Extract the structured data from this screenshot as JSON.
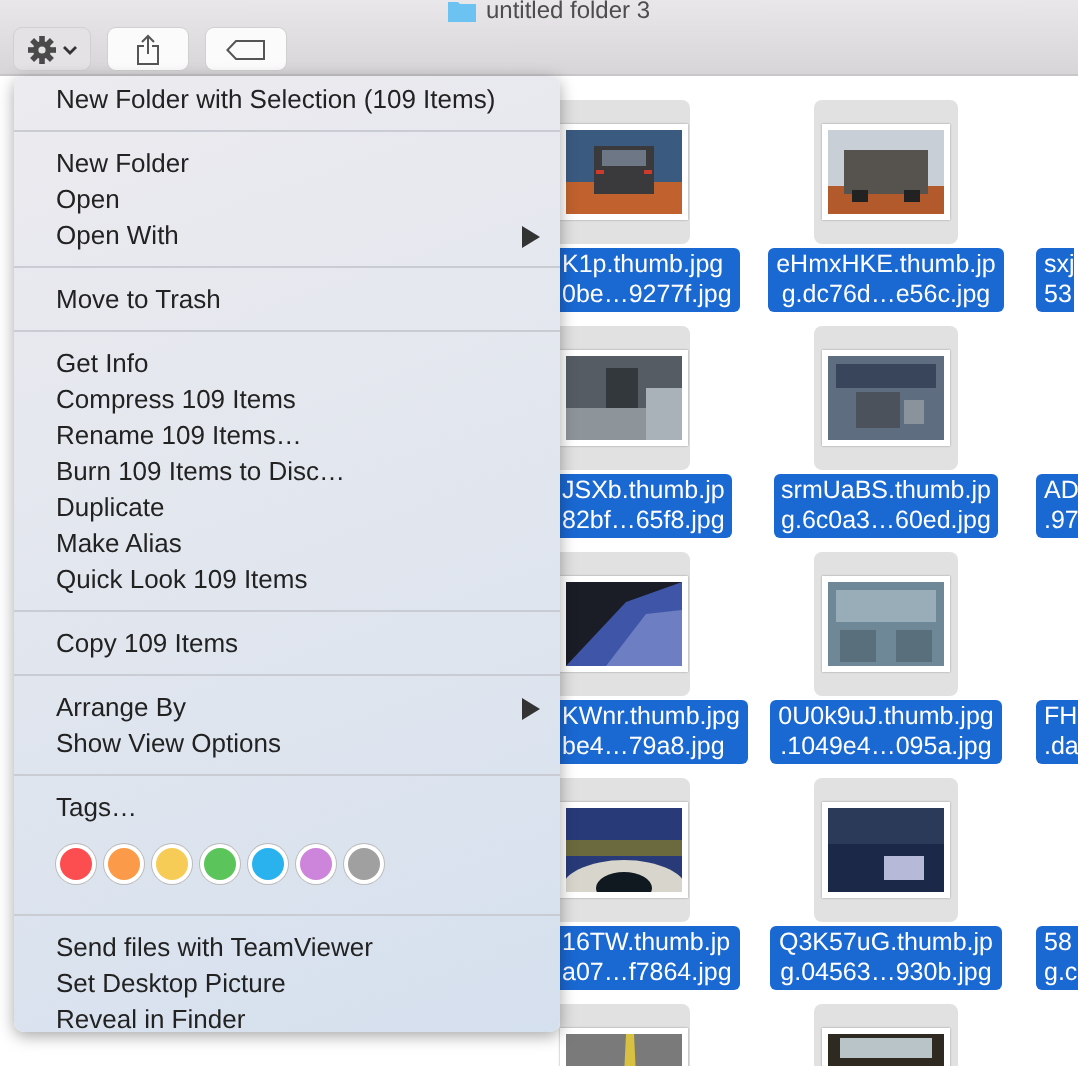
{
  "window": {
    "title": "untitled folder 3"
  },
  "toolbar": {
    "buttons": [
      {
        "kind": "action"
      },
      {
        "kind": "share"
      },
      {
        "kind": "tag"
      }
    ]
  },
  "files": [
    {
      "kind": "picture",
      "selected": true,
      "name": [
        "K1p.thumb.jpg",
        "0be…9277f.jpg"
      ]
    },
    {
      "kind": "picture",
      "selected": true,
      "name": [
        "eHmxHKE.thumb.jp",
        "g.dc76d…e56c.jpg"
      ]
    },
    {
      "kind": "label",
      "selected": true,
      "name": [
        "sxj",
        "53"
      ]
    },
    {
      "kind": "picture",
      "selected": true,
      "name": [
        "JSXb.thumb.jp",
        "82bf…65f8.jpg"
      ]
    },
    {
      "kind": "picture",
      "selected": true,
      "name": [
        "srmUaBS.thumb.jp",
        "g.6c0a3…60ed.jpg"
      ]
    },
    {
      "kind": "label",
      "selected": true,
      "name": [
        "AD",
        ".97"
      ]
    },
    {
      "kind": "picture",
      "selected": true,
      "name": [
        "KWnr.thumb.jpg",
        "be4…79a8.jpg"
      ]
    },
    {
      "kind": "picture",
      "selected": true,
      "name": [
        "0U0k9uJ.thumb.jpg",
        ".1049e4…095a.jpg"
      ]
    },
    {
      "kind": "label",
      "selected": true,
      "name": [
        "FH",
        ".da"
      ]
    },
    {
      "kind": "picture",
      "selected": true,
      "name": [
        "16TW.thumb.jp",
        "a07…f7864.jpg"
      ]
    },
    {
      "kind": "picture",
      "selected": true,
      "name": [
        "Q3K57uG.thumb.jp",
        "g.04563…930b.jpg"
      ]
    },
    {
      "kind": "label",
      "selected": true,
      "name": [
        "58",
        "g.c"
      ]
    },
    {
      "kind": "picture"
    },
    {
      "kind": "picture"
    }
  ],
  "menu": {
    "sections": [
      [
        {
          "kind": "item",
          "label": "New Folder with Selection (109 Items)"
        }
      ],
      [
        {
          "kind": "item",
          "label": "New Folder"
        },
        {
          "kind": "item",
          "label": "Open"
        },
        {
          "kind": "submenu",
          "label": "Open With"
        }
      ],
      [
        {
          "kind": "item",
          "label": "Move to Trash"
        }
      ],
      [
        {
          "kind": "item",
          "label": "Get Info"
        },
        {
          "kind": "item",
          "label": "Compress 109 Items"
        },
        {
          "kind": "item",
          "label": "Rename 109 Items…"
        },
        {
          "kind": "item",
          "label": "Burn 109 Items to Disc…"
        },
        {
          "kind": "item",
          "label": "Duplicate"
        },
        {
          "kind": "item",
          "label": "Make Alias"
        },
        {
          "kind": "item",
          "label": "Quick Look 109 Items"
        }
      ],
      [
        {
          "kind": "item",
          "label": "Copy 109 Items"
        }
      ],
      [
        {
          "kind": "submenu",
          "label": "Arrange By"
        },
        {
          "kind": "item",
          "label": "Show View Options"
        }
      ],
      [
        {
          "kind": "item",
          "label": "Tags…"
        },
        {
          "kind": "tags",
          "tags": [
            {
              "color": "#fc4e50"
            },
            {
              "color": "#fb9a48"
            },
            {
              "color": "#f6cc56"
            },
            {
              "color": "#5bc45a"
            },
            {
              "color": "#29b2ee"
            },
            {
              "color": "#cd84db"
            },
            {
              "color": "#a0a0a0"
            }
          ]
        }
      ],
      [
        {
          "kind": "item",
          "label": "Send files with TeamViewer"
        },
        {
          "kind": "item",
          "label": "Set Desktop Picture"
        },
        {
          "kind": "item",
          "label": "Reveal in Finder"
        }
      ]
    ]
  }
}
